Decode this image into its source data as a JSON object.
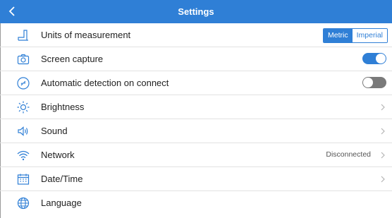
{
  "header": {
    "title": "Settings",
    "back_icon": "chevron-left-icon"
  },
  "settings": [
    {
      "label": "Units of measurement",
      "icon": "ruler-icon",
      "control": "segmented",
      "options": [
        "Metric",
        "Imperial"
      ],
      "selected": "Metric"
    },
    {
      "label": "Screen capture",
      "icon": "camera-icon",
      "control": "toggle",
      "value": true
    },
    {
      "label": "Automatic detection on connect",
      "icon": "link-icon",
      "control": "toggle",
      "value": false
    },
    {
      "label": "Brightness",
      "icon": "brightness-icon",
      "control": "chevron"
    },
    {
      "label": "Sound",
      "icon": "speaker-icon",
      "control": "chevron"
    },
    {
      "label": "Network",
      "icon": "wifi-icon",
      "control": "chevron",
      "status": "Disconnected"
    },
    {
      "label": "Date/Time",
      "icon": "calendar-icon",
      "control": "chevron"
    },
    {
      "label": "Language",
      "icon": "globe-icon",
      "control": "none"
    }
  ],
  "colors": {
    "accent": "#2f7fd6",
    "toggle_off": "#7a7a7a",
    "icon": "#2f7fd6"
  }
}
